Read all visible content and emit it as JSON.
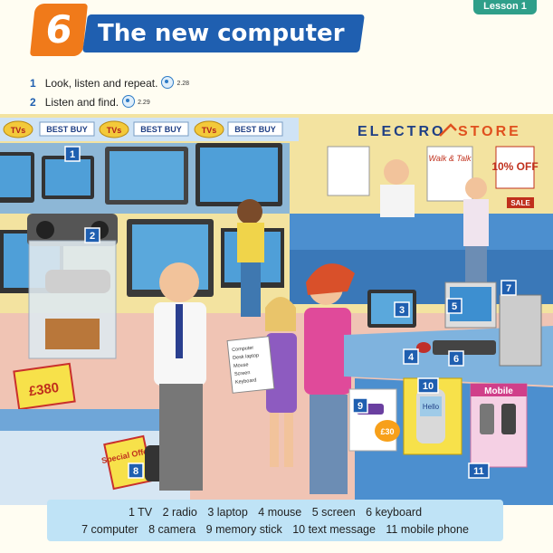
{
  "lesson_tab": "Lesson 1",
  "unit": {
    "number": "6",
    "title": "The new computer"
  },
  "instructions": [
    {
      "num": "1",
      "text": "Look, listen and repeat.",
      "track": "2.28"
    },
    {
      "num": "2",
      "text": "Listen and find.",
      "track": "2.29"
    }
  ],
  "store": {
    "shelf_signs": [
      "TVs",
      "BEST BUY",
      "TVs",
      "BEST BUY",
      "TVs",
      "BEST BUY"
    ],
    "name_left": "ELECTRO",
    "name_right": "STORE",
    "poster_walk_talk": "Walk & Talk",
    "poster_discount": "10% OFF",
    "poster_sale": "SALE",
    "price_tag": "£380",
    "special_offer": "Special Offer",
    "stick_price": "£30",
    "mobile_sign": "Mobile",
    "phone_screen": "Hello",
    "note_lines": [
      "Computer",
      "Desk laptop",
      "Mouse",
      "Screen",
      "Keyboard"
    ]
  },
  "callouts": [
    "1",
    "2",
    "3",
    "4",
    "5",
    "6",
    "7",
    "8",
    "9",
    "10",
    "11"
  ],
  "legend": {
    "row1": [
      "1 TV",
      "2 radio",
      "3 laptop",
      "4 mouse",
      "5 screen",
      "6 keyboard"
    ],
    "row2": [
      "7 computer",
      "8 camera",
      "9 memory stick",
      "10 text message",
      "11 mobile phone"
    ]
  },
  "colors": {
    "title_blue": "#1f5fb0",
    "badge_orange": "#f07a1a",
    "legend_blue": "#bfe3f6",
    "callout_blue": "#1f5fb0"
  }
}
